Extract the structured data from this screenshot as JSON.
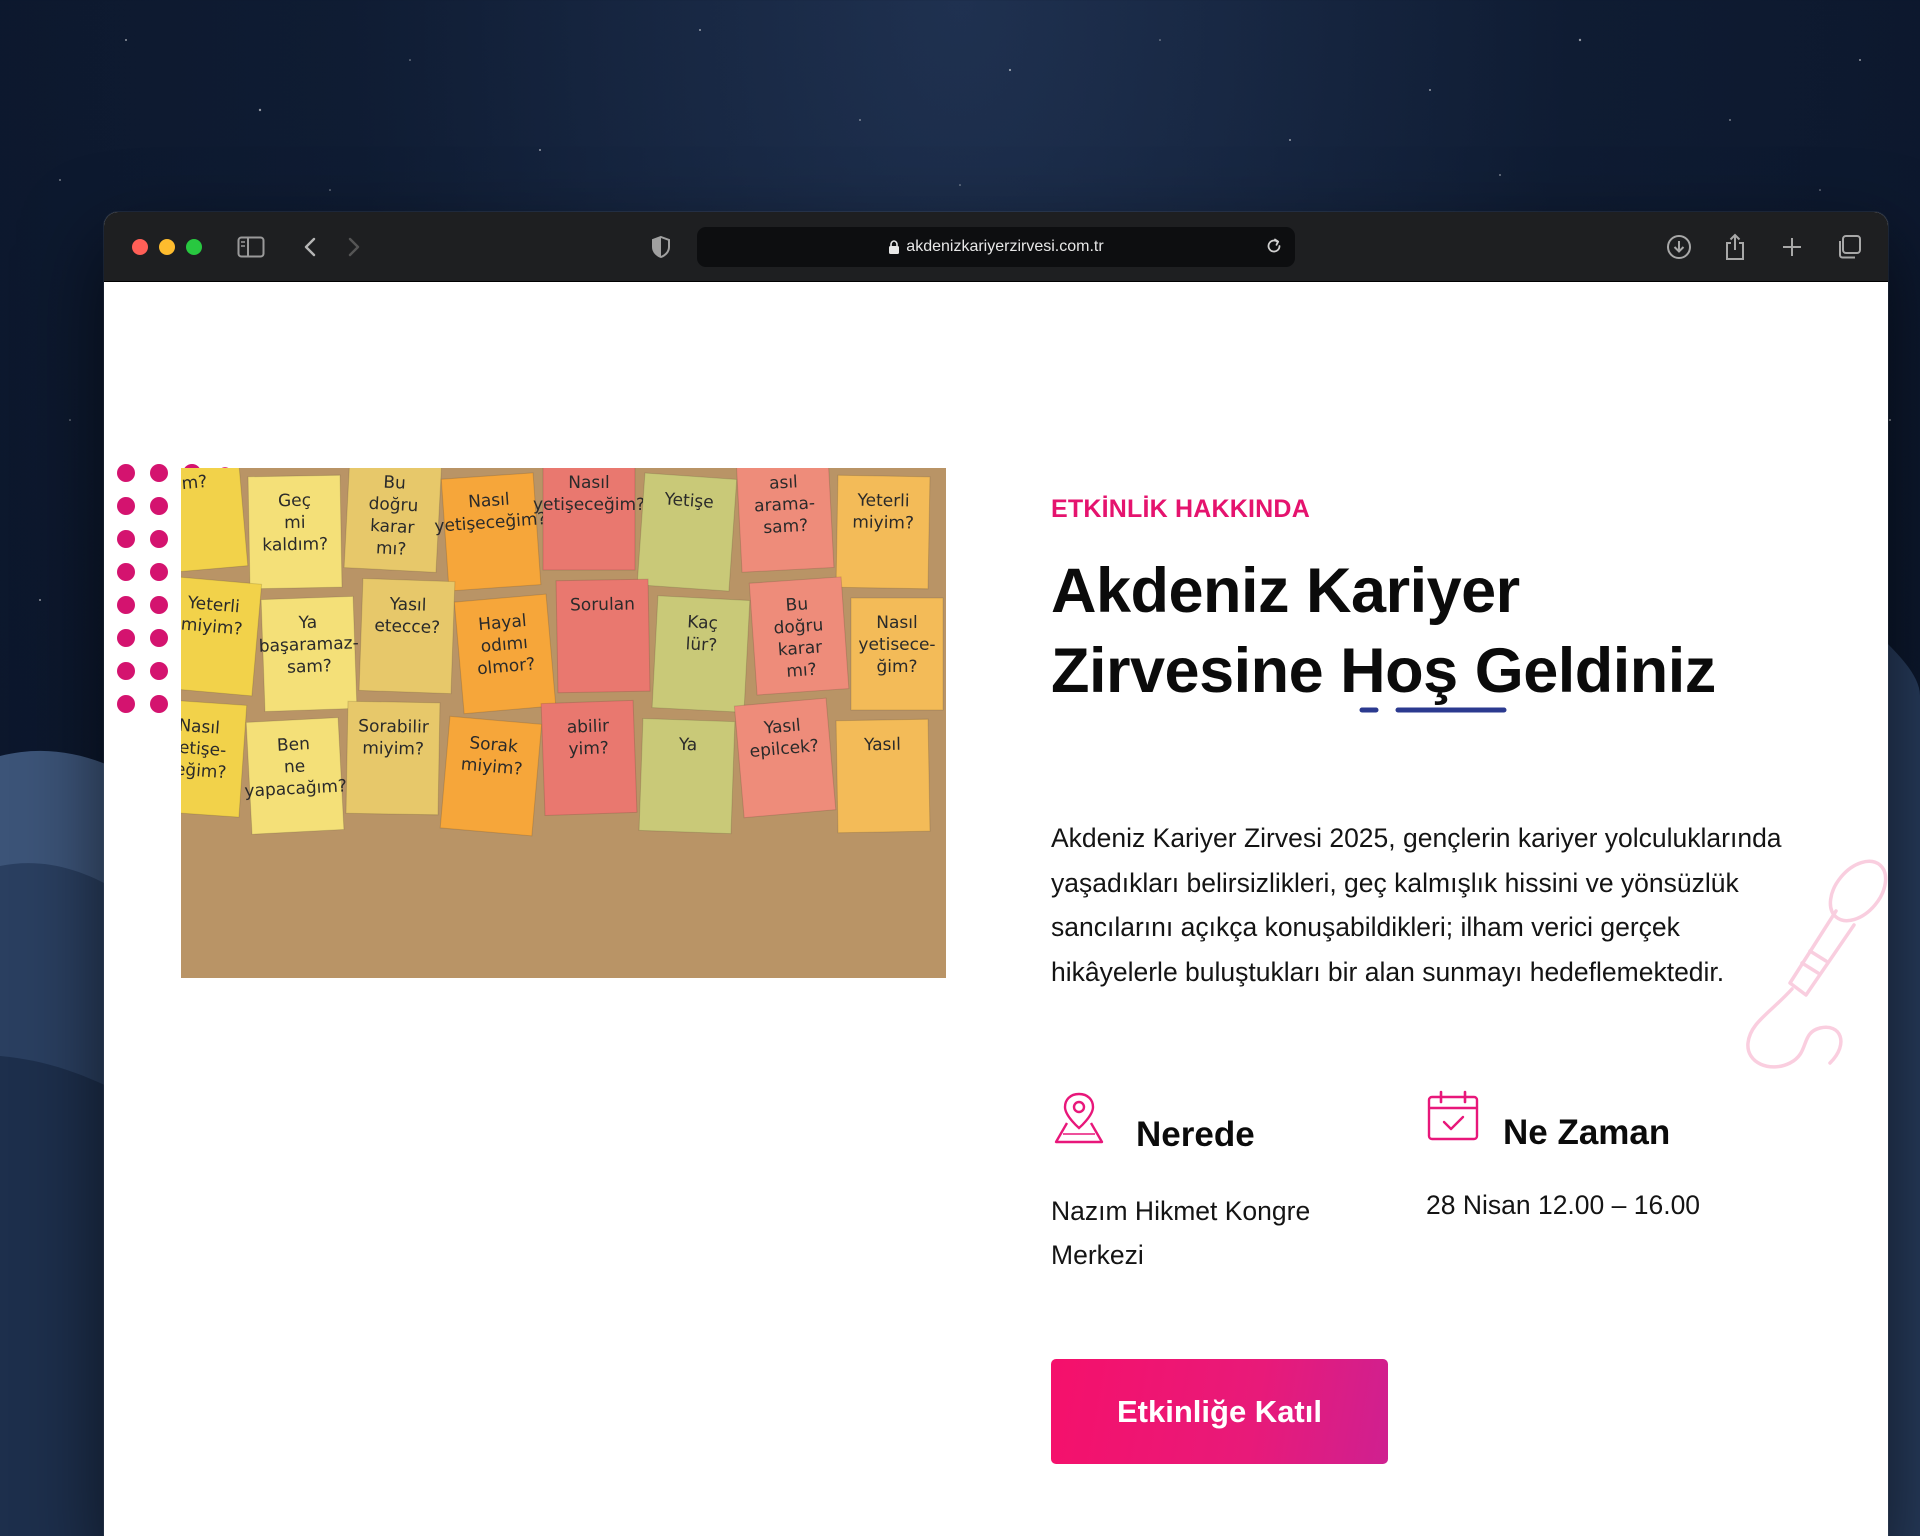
{
  "browser": {
    "url": "akdenizkariyerzirvesi.com.tr"
  },
  "section": {
    "eyebrow": "ETKİNLİK HAKKINDA",
    "title_line1": "Akdeniz Kariyer",
    "title_line2_pre": "Zirvesine ",
    "title_line2_highlight": "Hoş",
    "title_line2_post": " Geldiniz",
    "description": "Akdeniz Kariyer Zirvesi 2025, gençlerin kariyer yolculuklarında yaşadıkları belirsizlikleri, geç kalmışlık hissini ve yönsüzlük sancılarını açıkça konuşabildikleri; ilham verici gerçek hikâyelerle buluştukları bir alan sunmayı hedeflemektedir."
  },
  "where": {
    "title": "Nerede",
    "text": "Nazım Hikmet Kongre Merkezi"
  },
  "when": {
    "title": "Ne Zaman",
    "text": "28 Nisan 12.00 – 16.00"
  },
  "cta": {
    "label": "Etkinliğe Katıl"
  },
  "sticky_notes": [
    "m?",
    "Geç mi kaldım?",
    "Bu doğru karar mı?",
    "Nasıl yetişeceğim?",
    "Nasıl yetişeceğim?",
    "Yetişe",
    "asıl arama- sam?",
    "Yeterli miyim?",
    "Yeterli miyim?",
    "Ya başaramaz- sam?",
    "Yasıl etecce?",
    "Hayal odımı olmor?",
    "Sorulan",
    "Kaç lür?",
    "Bu doğru karar mı?",
    "Nasıl yetisece- ğim?",
    "Nasıl yetişe- ceğim?",
    "Ben ne yapacağım?",
    "Sorabilir miyim?",
    "Sorak miyim?",
    "abilir yim?",
    "Ya",
    "Yasıl epilcek?",
    "Yasıl"
  ],
  "colors": {
    "accent": "#e5136e",
    "underline": "#2b3a8f",
    "dots": "#d4136f"
  }
}
